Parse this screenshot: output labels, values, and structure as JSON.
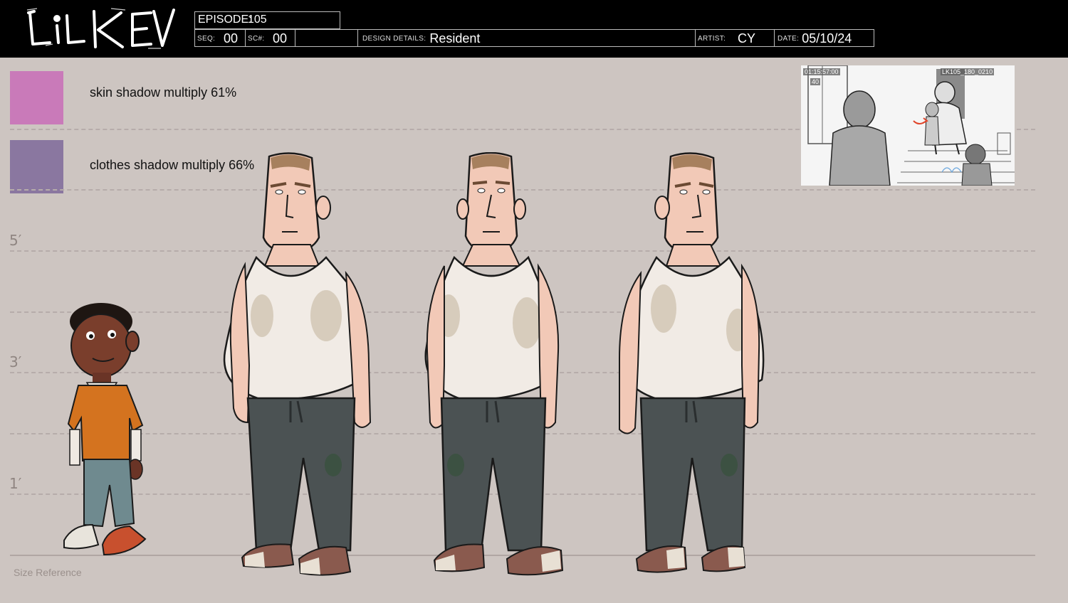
{
  "header": {
    "logo_text": "LiL KEV",
    "episode_label": "EPISODE:",
    "episode_value": "105",
    "seq_label": "SEQ:",
    "seq_value": "00",
    "sc_label": "SC#:",
    "sc_value": "00",
    "design_label": "DESIGN DETAILS:",
    "design_value": "Resident",
    "artist_label": "ARTIST:",
    "artist_value": "CY",
    "date_label": "DATE:",
    "date_value": "05/10/24"
  },
  "swatches": [
    {
      "label": "skin shadow multiply 61%",
      "color": "#c97ab9"
    },
    {
      "label": "clothes shadow multiply 66%",
      "color": "#8a77a0"
    }
  ],
  "height_marks": [
    "5′",
    "3′",
    "1′"
  ],
  "size_reference_label": "Size Reference",
  "storyboard": {
    "timecode": "01:15:57:00",
    "frame": "40",
    "shot_id": "LK105_180_0210"
  },
  "colors": {
    "background": "#cdc5c1",
    "header": "#000000",
    "skin": "#f2c9b7",
    "tank_top": "#f1ebe5",
    "pants": "#4b5253",
    "shoes": "#8a5a4e",
    "kev_shirt": "#d4731f",
    "kev_pants": "#6f8a8f"
  }
}
